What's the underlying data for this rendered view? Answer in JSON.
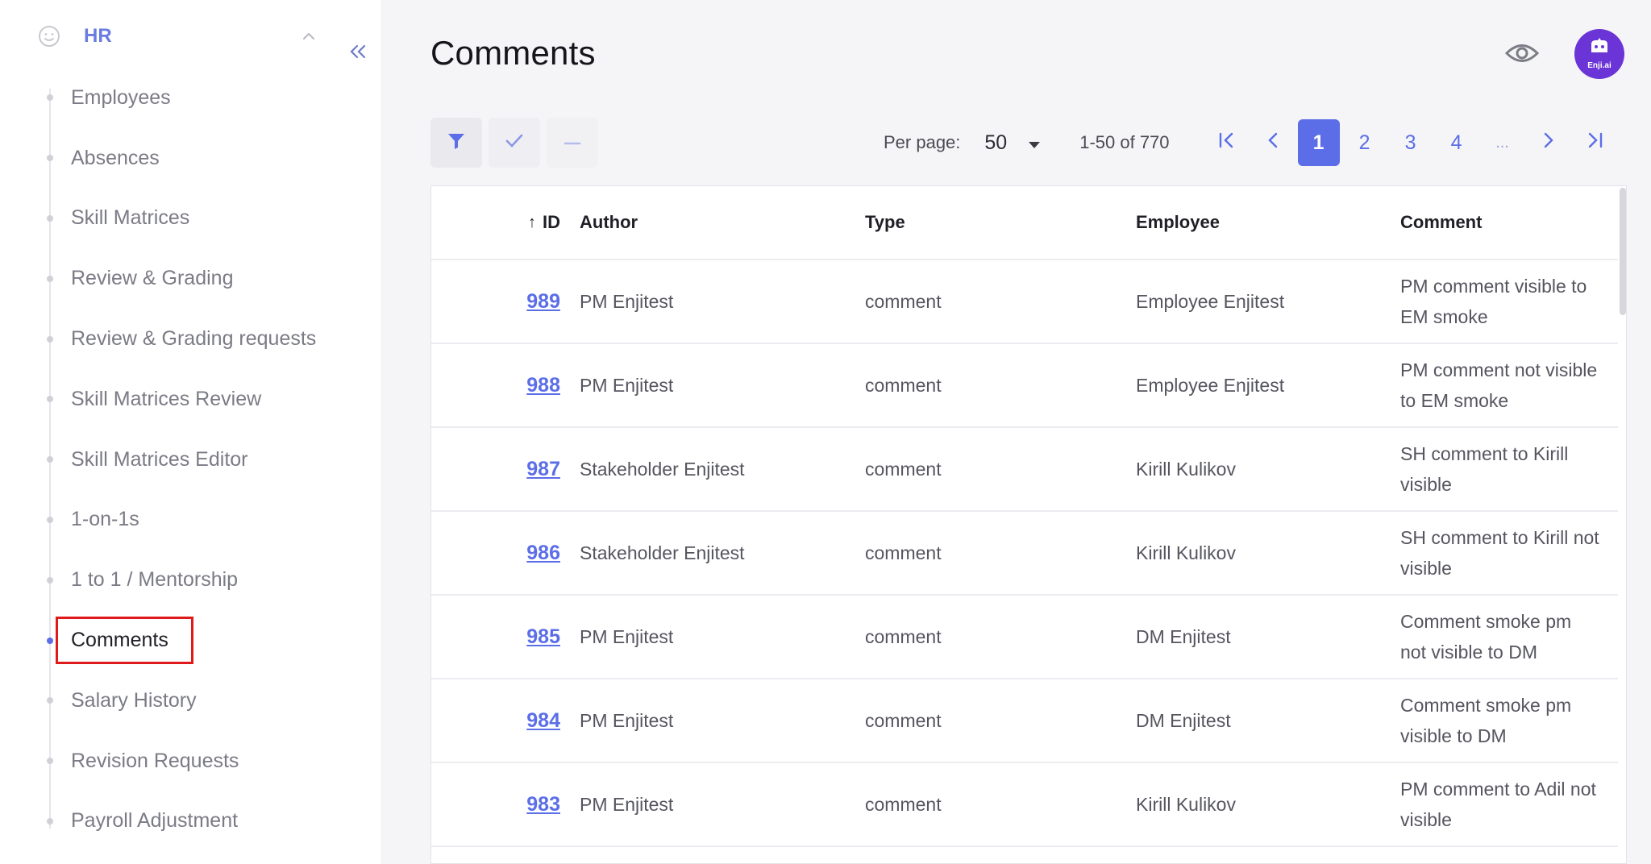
{
  "sidebar": {
    "section_title": "HR",
    "items": [
      {
        "label": "Employees",
        "active": false
      },
      {
        "label": "Absences",
        "active": false
      },
      {
        "label": "Skill Matrices",
        "active": false
      },
      {
        "label": "Review & Grading",
        "active": false
      },
      {
        "label": "Review & Grading requests",
        "active": false
      },
      {
        "label": "Skill Matrices Review",
        "active": false
      },
      {
        "label": "Skill Matrices Editor",
        "active": false
      },
      {
        "label": "1-on-1s",
        "active": false
      },
      {
        "label": "1 to 1 / Mentorship",
        "active": false
      },
      {
        "label": "Comments",
        "active": true
      },
      {
        "label": "Salary History",
        "active": false
      },
      {
        "label": "Revision Requests",
        "active": false
      },
      {
        "label": "Payroll Adjustment",
        "active": false
      }
    ]
  },
  "header": {
    "title": "Comments",
    "avatar_text": "Enji.ai"
  },
  "toolbar": {
    "per_page_label": "Per page:",
    "per_page_value": "50",
    "range_text": "1-50 of 770",
    "pages": [
      "1",
      "2",
      "3",
      "4",
      "..."
    ],
    "current_page": "1"
  },
  "table": {
    "columns": [
      "ID",
      "Author",
      "Type",
      "Employee",
      "Comment"
    ],
    "sort_column": "ID",
    "rows": [
      {
        "id": "989",
        "author": "PM Enjitest",
        "type": "comment",
        "employee": "Employee Enjitest",
        "comment": "PM comment visible to EM smoke"
      },
      {
        "id": "988",
        "author": "PM Enjitest",
        "type": "comment",
        "employee": "Employee Enjitest",
        "comment": "PM comment not visible to EM smoke"
      },
      {
        "id": "987",
        "author": "Stakeholder Enjitest",
        "type": "comment",
        "employee": "Kirill Kulikov",
        "comment": "SH comment to Kirill visible"
      },
      {
        "id": "986",
        "author": "Stakeholder Enjitest",
        "type": "comment",
        "employee": "Kirill Kulikov",
        "comment": "SH comment to Kirill not visible"
      },
      {
        "id": "985",
        "author": "PM Enjitest",
        "type": "comment",
        "employee": "DM Enjitest",
        "comment": "Comment smoke pm not visible to DM"
      },
      {
        "id": "984",
        "author": "PM Enjitest",
        "type": "comment",
        "employee": "DM Enjitest",
        "comment": "Comment smoke pm visible to DM"
      },
      {
        "id": "983",
        "author": "PM Enjitest",
        "type": "comment",
        "employee": "Kirill Kulikov",
        "comment": "PM comment to Adil not visible"
      }
    ]
  },
  "colors": {
    "accent": "#5b6ee8",
    "highlight_box": "#e01a1a",
    "avatar_bg": "#6a34d6"
  },
  "icons": {
    "section": "smiley-icon",
    "chevron": "chevron-up-icon",
    "collapse": "double-chevron-left-icon",
    "eye": "eye-icon",
    "filter": "filter-icon",
    "select": "check-icon",
    "deselect": "minus-icon"
  }
}
